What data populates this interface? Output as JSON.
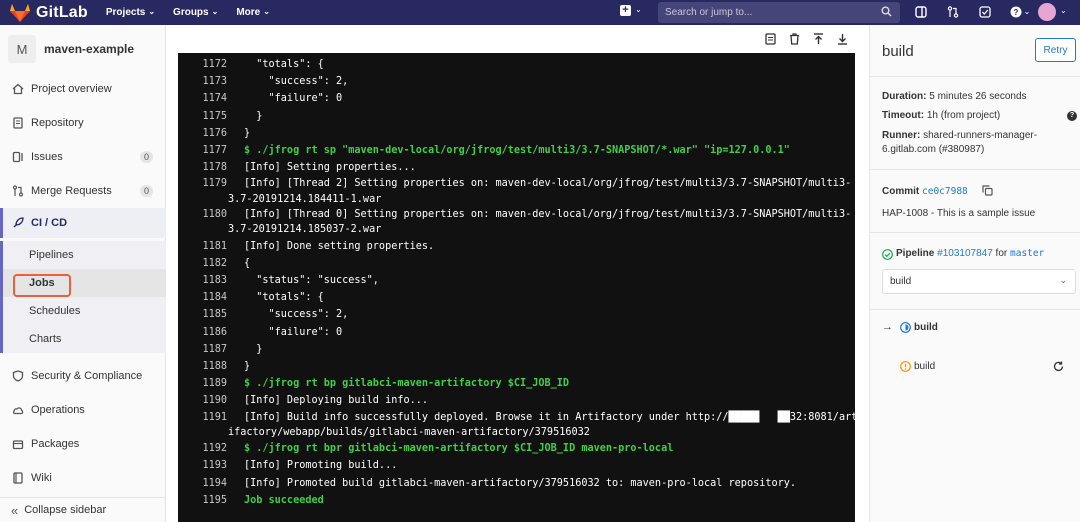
{
  "topbar": {
    "brand": "GitLab",
    "nav": [
      {
        "label": "Projects"
      },
      {
        "label": "Groups"
      },
      {
        "label": "More"
      }
    ],
    "search_placeholder": "Search or jump to..."
  },
  "sidebar": {
    "project_initial": "M",
    "project_name": "maven-example",
    "items": [
      {
        "label": "Project overview",
        "icon": "home-icon"
      },
      {
        "label": "Repository",
        "icon": "repository-icon"
      },
      {
        "label": "Issues",
        "icon": "issues-icon",
        "count": "0"
      },
      {
        "label": "Merge Requests",
        "icon": "merge-request-icon",
        "count": "0"
      },
      {
        "label": "CI / CD",
        "icon": "rocket-icon"
      },
      {
        "label": "Security & Compliance",
        "icon": "shield-icon"
      },
      {
        "label": "Operations",
        "icon": "cloud-icon"
      },
      {
        "label": "Packages",
        "icon": "package-icon"
      },
      {
        "label": "Wiki",
        "icon": "book-icon"
      }
    ],
    "cicd_sub": [
      {
        "label": "Pipelines"
      },
      {
        "label": "Jobs"
      },
      {
        "label": "Schedules"
      },
      {
        "label": "Charts"
      }
    ],
    "collapse_label": "Collapse sidebar"
  },
  "log": {
    "lines": [
      {
        "n": "1172",
        "t": "  \"totals\": {",
        "g": false
      },
      {
        "n": "1173",
        "t": "    \"success\": 2,",
        "g": false
      },
      {
        "n": "1174",
        "t": "    \"failure\": 0",
        "g": false
      },
      {
        "n": "1175",
        "t": "  }",
        "g": false
      },
      {
        "n": "1176",
        "t": "}",
        "g": false
      },
      {
        "n": "1177",
        "t": "$ ./jfrog rt sp \"maven-dev-local/org/jfrog/test/multi3/3.7-SNAPSHOT/*.war\" \"ip=127.0.0.1\"",
        "g": true
      },
      {
        "n": "1178",
        "t": "[Info] Setting properties...",
        "g": false
      },
      {
        "n": "1179",
        "t": "[Info] [Thread 2] Setting properties on: maven-dev-local/org/jfrog/test/multi3/3.7-SNAPSHOT/multi3-",
        "g": false,
        "c": "3.7-20191214.184411-1.war"
      },
      {
        "n": "1180",
        "t": "[Info] [Thread 0] Setting properties on: maven-dev-local/org/jfrog/test/multi3/3.7-SNAPSHOT/multi3-",
        "g": false,
        "c": "3.7-20191214.185037-2.war"
      },
      {
        "n": "1181",
        "t": "[Info] Done setting properties.",
        "g": false
      },
      {
        "n": "1182",
        "t": "{",
        "g": false
      },
      {
        "n": "1183",
        "t": "  \"status\": \"success\",",
        "g": false
      },
      {
        "n": "1184",
        "t": "  \"totals\": {",
        "g": false
      },
      {
        "n": "1185",
        "t": "    \"success\": 2,",
        "g": false
      },
      {
        "n": "1186",
        "t": "    \"failure\": 0",
        "g": false
      },
      {
        "n": "1187",
        "t": "  }",
        "g": false
      },
      {
        "n": "1188",
        "t": "}",
        "g": false
      },
      {
        "n": "1189",
        "t": "$ ./jfrog rt bp gitlabci-maven-artifactory $CI_JOB_ID",
        "g": true
      },
      {
        "n": "1190",
        "t": "[Info] Deploying build info...",
        "g": false
      },
      {
        "n": "1191",
        "t": "[Info] Build info successfully deployed. Browse it in Artifactory under http://█████   ██32:8081/art",
        "g": false,
        "c": "ifactory/webapp/builds/gitlabci-maven-artifactory/379516032"
      },
      {
        "n": "1192",
        "t": "$ ./jfrog rt bpr gitlabci-maven-artifactory $CI_JOB_ID maven-pro-local",
        "g": true
      },
      {
        "n": "1193",
        "t": "[Info] Promoting build...",
        "g": false
      },
      {
        "n": "1194",
        "t": "[Info] Promoted build gitlabci-maven-artifactory/379516032 to: maven-pro-local repository.",
        "g": false
      },
      {
        "n": "1195",
        "t": "Job succeeded",
        "g": true
      }
    ]
  },
  "job": {
    "title": "build",
    "retry_label": "Retry",
    "duration_label": "Duration:",
    "duration": "5 minutes 26 seconds",
    "timeout_label": "Timeout:",
    "timeout": "1h (from project)",
    "runner_label": "Runner:",
    "runner_line1": "shared-runners-manager-",
    "runner_line2": "6.gitlab.com (#380987)",
    "commit_label": "Commit",
    "commit_sha": "ce0c7988",
    "commit_message": "HAP-1008 - This is a sample issue",
    "pipeline_label": "Pipeline",
    "pipeline_id": "#103107847",
    "pipeline_for": "for",
    "branch": "master",
    "stage_select": "build",
    "stage_name": "build",
    "job_name": "build"
  },
  "colors": {
    "nav_bg": "#292961",
    "accent": "#1f78d1",
    "success_green": "#3fd048",
    "highlight": "#e8603c"
  }
}
